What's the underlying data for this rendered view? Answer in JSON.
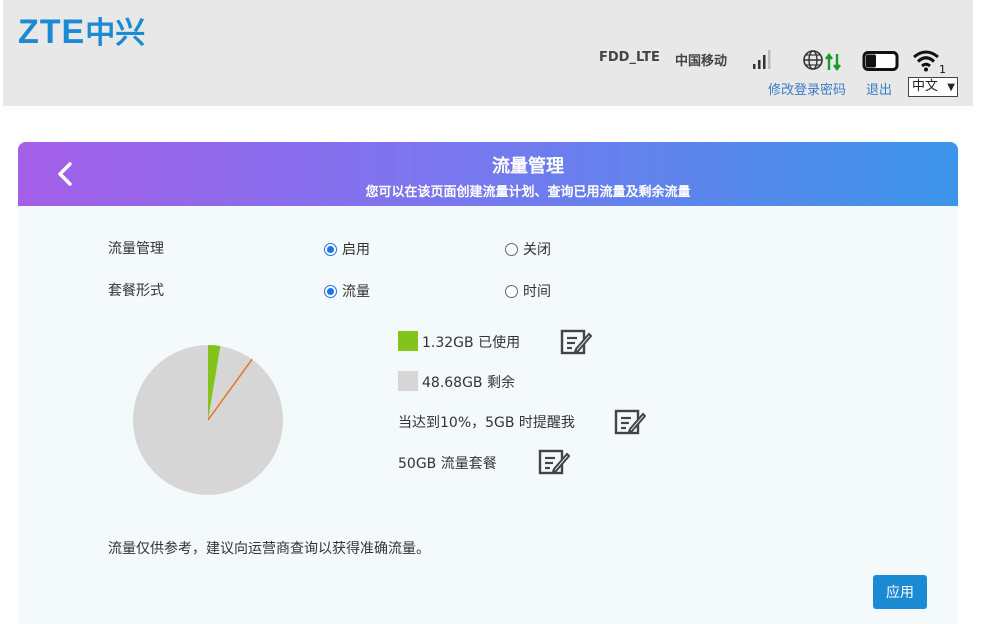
{
  "header": {
    "logo_latin": "ZTE",
    "logo_cn": "中兴",
    "network_type": "FDD_LTE",
    "carrier": "中国移动",
    "wifi_clients": "1",
    "change_password": "修改登录密码",
    "logout": "退出",
    "language": "中文"
  },
  "banner": {
    "title": "流量管理",
    "subtitle": "您可以在该页面创建流量计划、查询已用流量及剩余流量"
  },
  "form": {
    "traffic_label": "流量管理",
    "traffic_on": "启用",
    "traffic_off": "关闭",
    "traffic_selected": "启用",
    "plan_label": "套餐形式",
    "plan_data": "流量",
    "plan_time": "时间",
    "plan_selected": "流量"
  },
  "usage": {
    "used_text": "1.32GB 已使用",
    "remaining_text": "48.68GB 剩余",
    "alert_text": "当达到10%，5GB 时提醒我",
    "plan_text": "50GB 流量套餐",
    "used_gb": 1.32,
    "total_gb": 50,
    "alert_percent": 10,
    "used_color": "#84c31e",
    "remaining_color": "#d6d6d6",
    "alert_color": "#f06a1a"
  },
  "note": "流量仅供参考，建议向运营商查询以获得准确流量。",
  "apply_label": "应用"
}
